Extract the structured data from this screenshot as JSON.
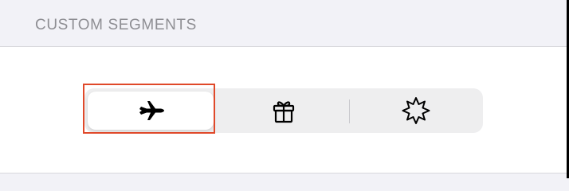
{
  "section": {
    "title": "CUSTOM SEGMENTS"
  },
  "segmented_control": {
    "selected_index": 0,
    "segments": [
      {
        "icon": "airplane-icon",
        "selected": true
      },
      {
        "icon": "gift-icon",
        "selected": false
      },
      {
        "icon": "burst-icon",
        "selected": false
      }
    ]
  },
  "colors": {
    "group_background": "#f2f2f7",
    "header_text": "#8e8e93",
    "control_background": "#eeeeef",
    "highlight": "#e0492a"
  }
}
